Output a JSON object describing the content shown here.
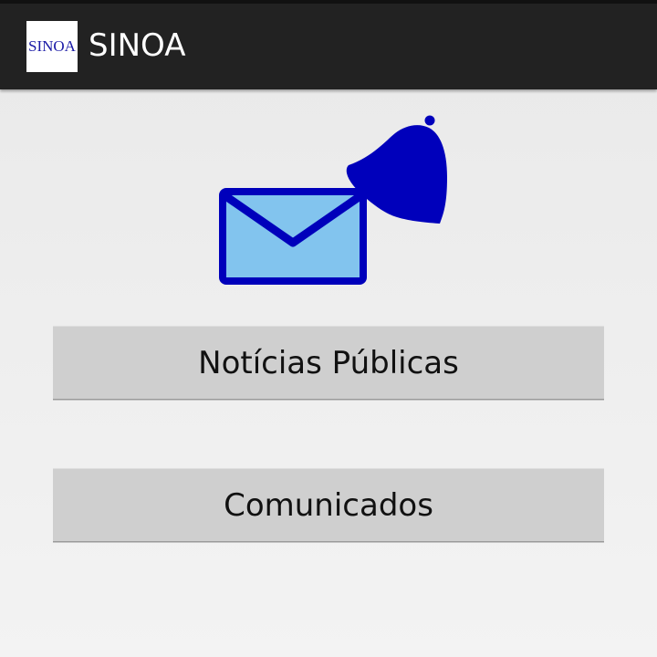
{
  "app": {
    "title": "SINOA",
    "logo_text": "SINOA"
  },
  "hero": {
    "icons": [
      "envelope-icon",
      "bell-icon"
    ],
    "colors": {
      "primary": "#0000bb",
      "envelope_fill": "#82c4ee"
    }
  },
  "buttons": {
    "news_label": "Notícias Públicas",
    "comms_label": "Comunicados"
  },
  "colors": {
    "action_bar": "#222222",
    "button_bg": "#cfcfcf",
    "background": "#eeeeee"
  }
}
